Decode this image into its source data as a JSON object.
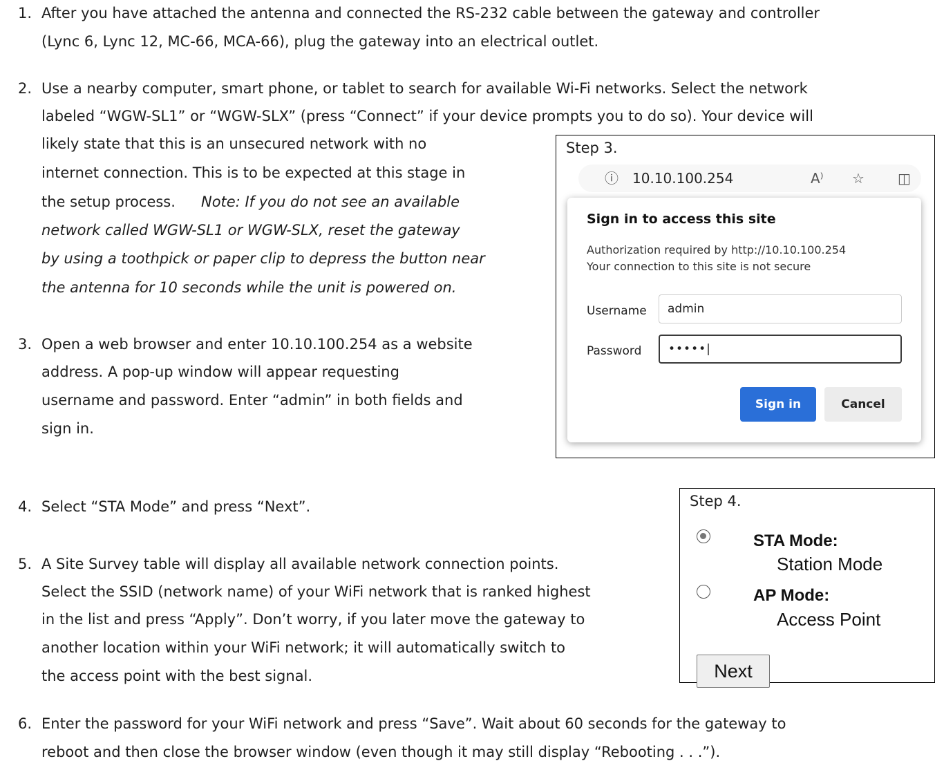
{
  "steps": {
    "s1": {
      "number": "1.",
      "line1": "After you have attached the antenna and connected the RS-232 cable between the gateway and controller",
      "line2": "(Lync 6, Lync 12, MC-66, MCA-66), plug the gateway into an electrical outlet."
    },
    "s2": {
      "number": "2.",
      "line1": "Use a nearby computer, smart phone, or tablet to search for available Wi-Fi networks.  Select the network",
      "line2": "labeled “WGW-SL1” or “WGW-SLX” (press “Connect” if your device prompts you to do so).  Your device will",
      "line3": "likely state that this is an unsecured network with no",
      "line4": "internet connection.  This is to be expected at this stage in",
      "line5": "the setup process.",
      "note1": "Note: If you do not see an available",
      "note2": "network called WGW-SL1 or WGW-SLX, reset the gateway",
      "note3": "by using a toothpick or paper clip to depress the button near",
      "note4": "the antenna for 10 seconds while the unit is powered on."
    },
    "s3": {
      "number": "3.",
      "line1": "Open a web browser and enter 10.10.100.254 as a website",
      "line2": "address.  A pop-up window will appear requesting",
      "line3": "username and password.  Enter “admin” in both fields and",
      "line4": "sign in."
    },
    "s4": {
      "number": "4.",
      "line1": "Select “STA Mode” and press “Next”."
    },
    "s5": {
      "number": "5.",
      "line1": "A Site Survey table will display all available network connection points.",
      "line2": "Select the SSID (network name) of your WiFi network that is ranked highest",
      "line3": "in the list and press “Apply”.  Don’t worry, if you later move the gateway to",
      "line4": "another location within your WiFi network; it will automatically switch to",
      "line5": "the access point with the best signal."
    },
    "s6": {
      "number": "6.",
      "line1": "Enter the password for your WiFi network and press “Save”. Wait about 60 seconds for the gateway to",
      "line2": "reboot and then close the browser window (even though it may still display “Rebooting . . .”)."
    }
  },
  "fig3": {
    "caption": "Step 3.",
    "address": "10.10.100.254",
    "info_icon": "ⓘ",
    "read_aloud_icon": "A⁾",
    "favorite_icon": "☆",
    "split_icon": "◫",
    "dialog": {
      "title": "Sign in to access this site",
      "auth": "Authorization required by http://10.10.100.254",
      "secure": "Your connection to this site is not secure",
      "username_label": "Username",
      "username_value": "admin",
      "password_label": "Password",
      "password_value": "•••••|",
      "signin": "Sign in",
      "cancel": "Cancel"
    }
  },
  "fig4": {
    "caption": "Step 4.",
    "sta_name": "STA Mode:",
    "sta_desc": "Station Mode",
    "ap_name": "AP Mode:",
    "ap_desc": "Access Point",
    "next": "Next"
  }
}
